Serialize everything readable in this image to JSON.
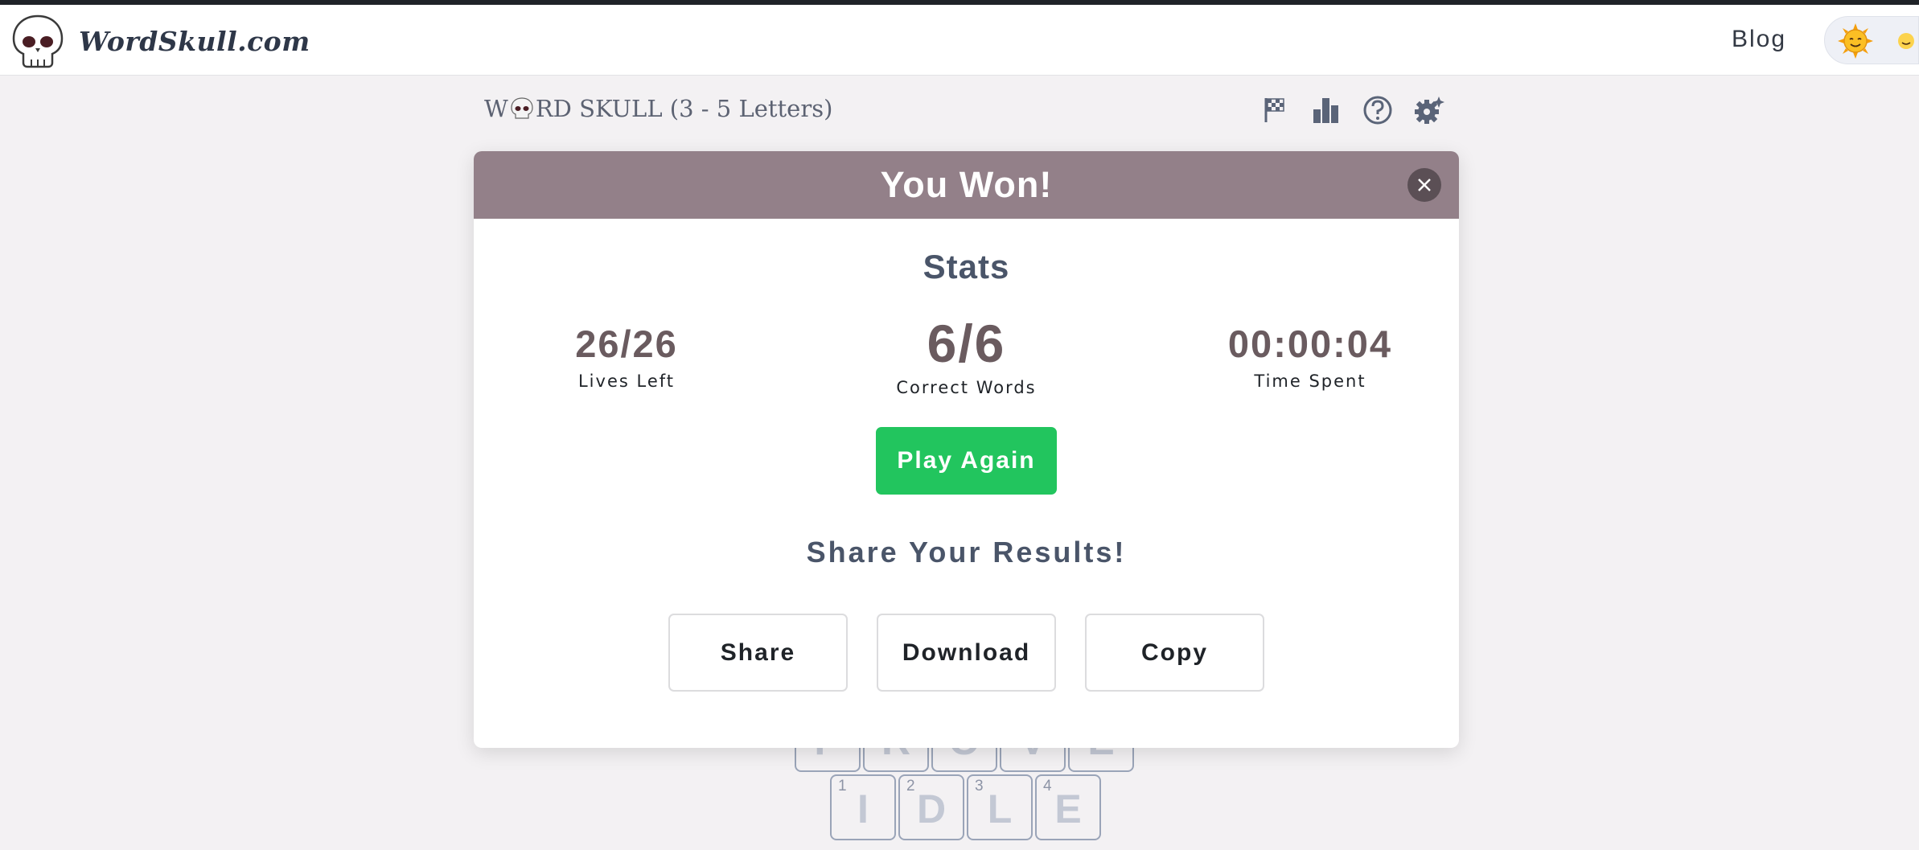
{
  "site": {
    "brand": "WordSkull.com",
    "blog_label": "Blog"
  },
  "game": {
    "title_prefix": "W",
    "title_suffix": "RD SKULL (3 - 5 Letters)"
  },
  "board": {
    "partial_row": [
      "P",
      "R",
      "O",
      "V",
      "E"
    ],
    "word_row": [
      {
        "num": "1",
        "letter": "I"
      },
      {
        "num": "2",
        "letter": "D"
      },
      {
        "num": "3",
        "letter": "L"
      },
      {
        "num": "4",
        "letter": "E"
      }
    ]
  },
  "modal": {
    "title": "You Won!",
    "stats_heading": "Stats",
    "lives": {
      "value": "26/26",
      "label": "Lives Left"
    },
    "words": {
      "value": "6/6",
      "label": "Correct Words"
    },
    "time": {
      "value": "00:00:04",
      "label": "Time Spent"
    },
    "play_again": "Play Again",
    "share_heading": "Share Your Results!",
    "share_label": "Share",
    "download_label": "Download",
    "copy_label": "Copy"
  },
  "colors": {
    "modal_header": "#938089",
    "play_button": "#22c55e",
    "stat_value": "#6a5b5f",
    "heading": "#4a5569"
  },
  "icons": [
    "skull-logo-icon",
    "sun-icon",
    "flag-icon",
    "bar-chart-icon",
    "help-icon",
    "settings-icon",
    "close-icon"
  ]
}
